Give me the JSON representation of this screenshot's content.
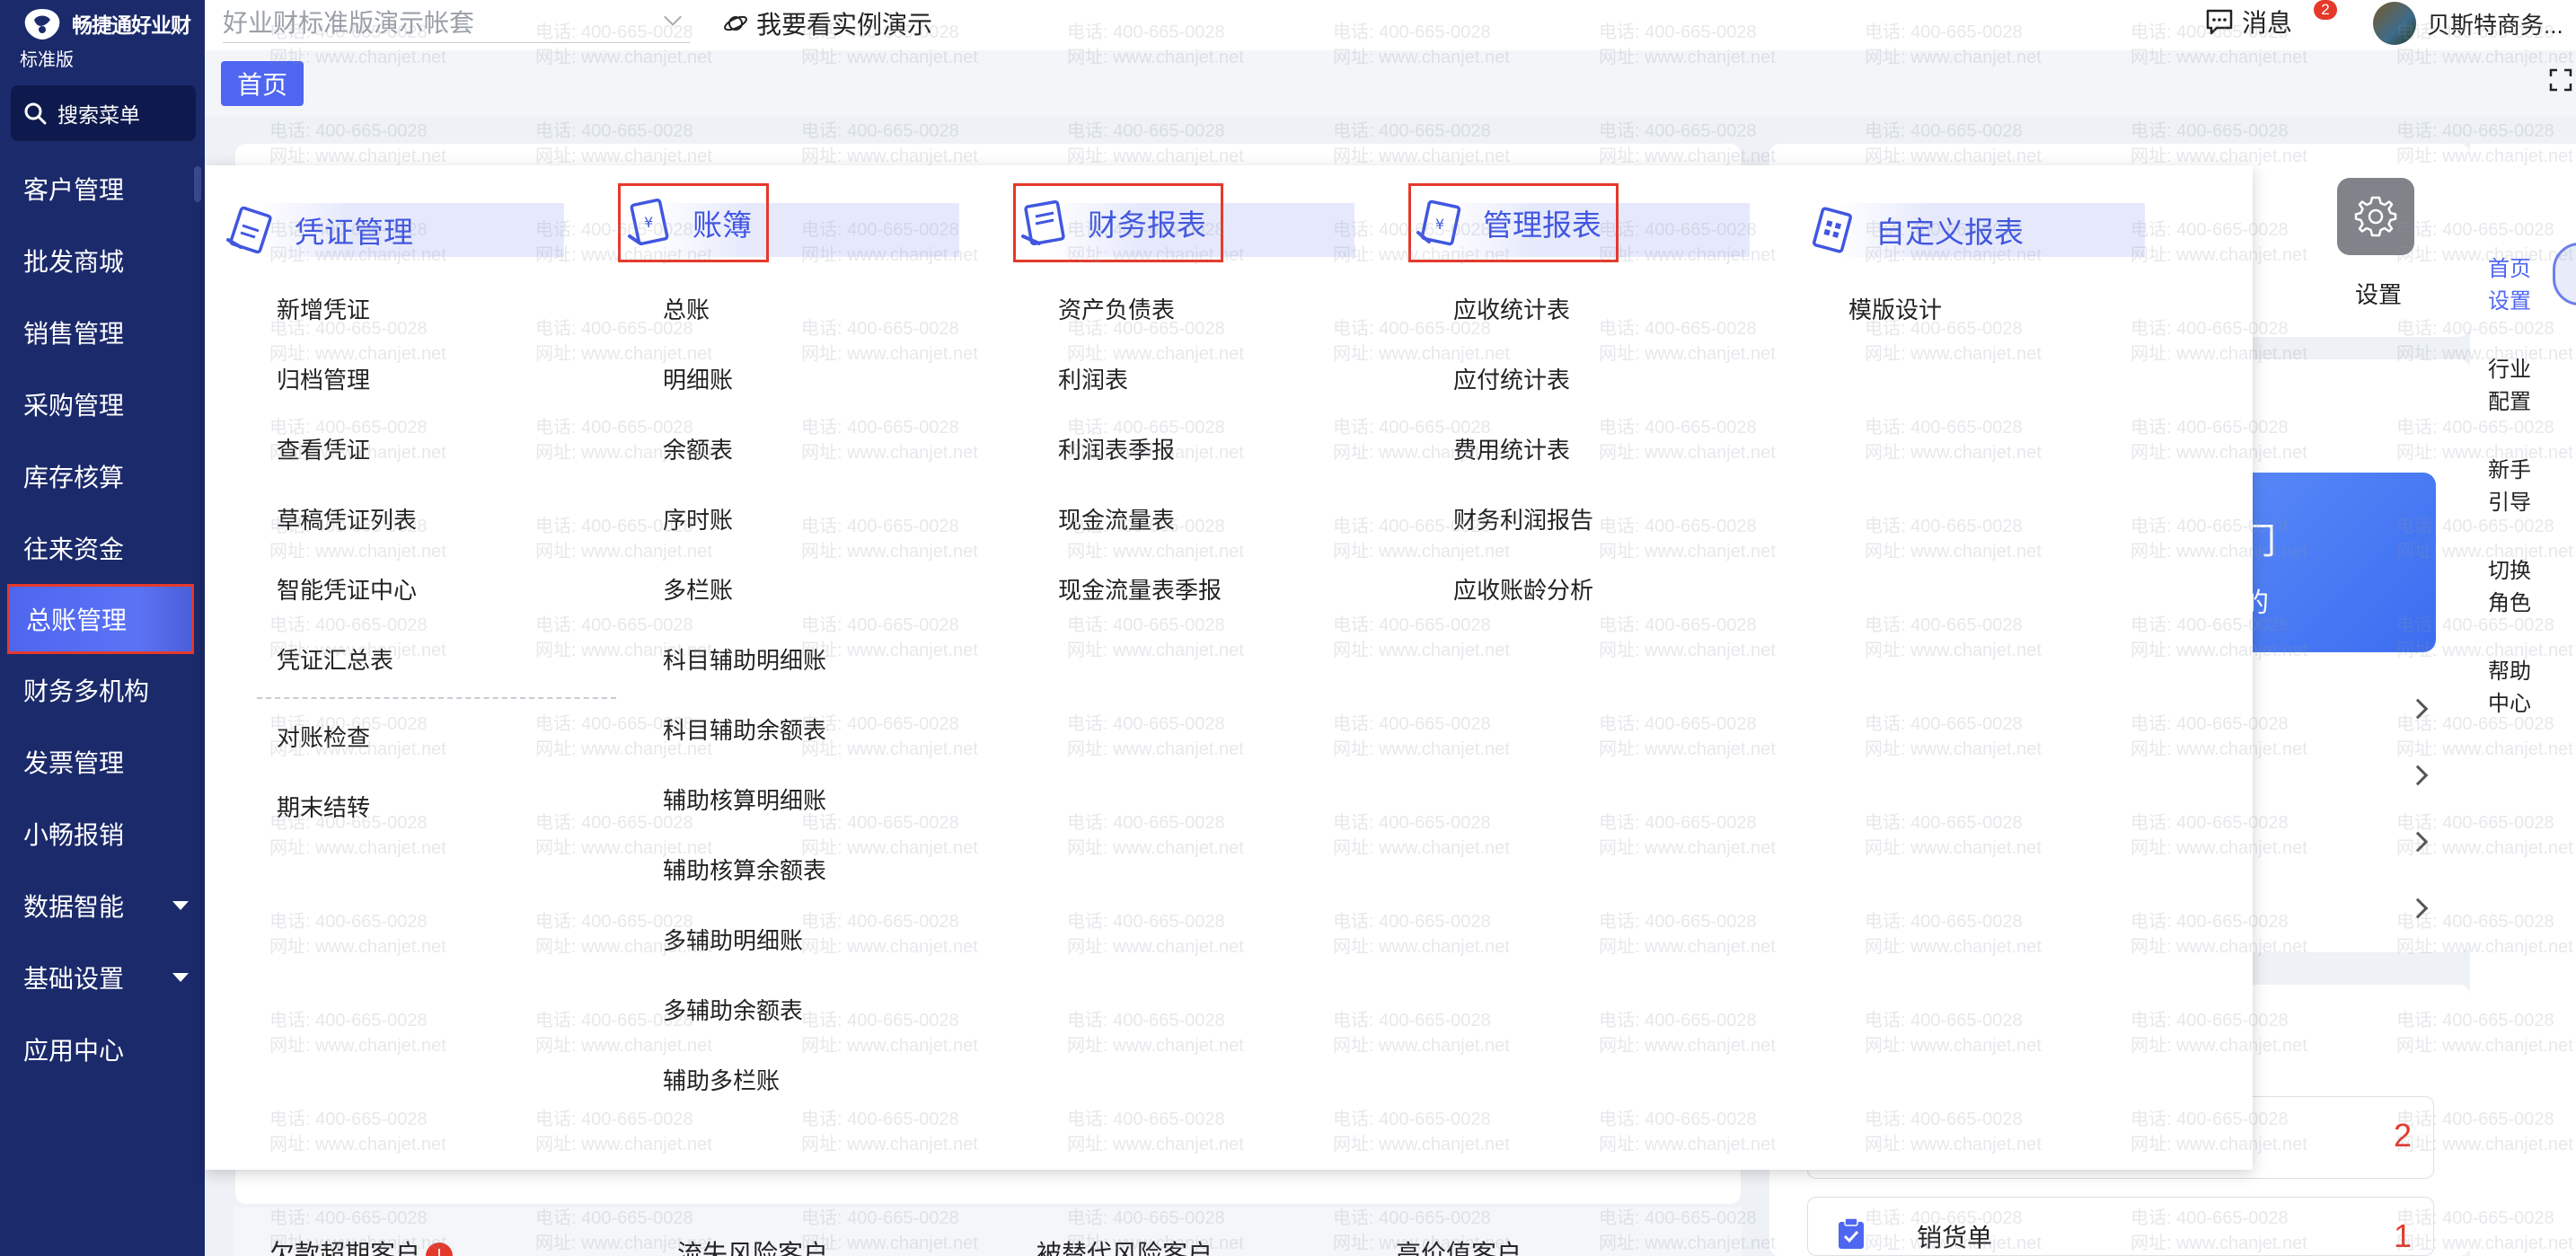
{
  "app": {
    "logo_text": "畅捷通好业财",
    "edition": "标准版",
    "search_menu_label": "搜索菜单"
  },
  "sidebar": {
    "items": [
      {
        "label": "客户管理"
      },
      {
        "label": "批发商城"
      },
      {
        "label": "销售管理"
      },
      {
        "label": "采购管理"
      },
      {
        "label": "库存核算"
      },
      {
        "label": "往来资金"
      },
      {
        "label": "总账管理",
        "active": true
      },
      {
        "label": "财务多机构"
      },
      {
        "label": "发票管理"
      },
      {
        "label": "小畅报销"
      },
      {
        "label": "数据智能",
        "has_submenu": true
      },
      {
        "label": "基础设置",
        "has_submenu": true
      },
      {
        "label": "应用中心"
      }
    ]
  },
  "topbar": {
    "account_placeholder": "好业财标准版演示帐套",
    "demo_link": "我要看实例演示",
    "messages_label": "消息",
    "messages_count": "2",
    "user_name": "贝斯特商务..."
  },
  "tabs": {
    "home": "首页"
  },
  "mega_menu": {
    "columns": [
      {
        "title": "凭证管理",
        "icon": "voucher-icon",
        "highlighted": false,
        "groups": [
          [
            "新增凭证",
            "归档管理",
            "查看凭证",
            "草稿凭证列表",
            "智能凭证中心",
            "凭证汇总表"
          ],
          [
            "对账检查",
            "期末结转"
          ]
        ]
      },
      {
        "title": "账簿",
        "icon": "ledger-icon",
        "highlighted": true,
        "groups": [
          [
            "总账",
            "明细账",
            "余额表",
            "序时账",
            "多栏账",
            "科目辅助明细账",
            "科目辅助余额表",
            "辅助核算明细账",
            "辅助核算余额表",
            "多辅助明细账",
            "多辅助余额表",
            "辅助多栏账"
          ]
        ]
      },
      {
        "title": "财务报表",
        "icon": "financial-report-icon",
        "highlighted": true,
        "groups": [
          [
            "资产负债表",
            "利润表",
            "利润表季报",
            "现金流量表",
            "现金流量表季报"
          ]
        ]
      },
      {
        "title": "管理报表",
        "icon": "management-report-icon",
        "highlighted": true,
        "groups": [
          [
            "应收统计表",
            "应付统计表",
            "费用统计表",
            "财务利润报告",
            "应收账龄分析"
          ]
        ]
      },
      {
        "title": "自定义报表",
        "icon": "custom-report-icon",
        "highlighted": false,
        "groups": [
          [
            "模版设计"
          ]
        ]
      }
    ]
  },
  "right_panel": {
    "settings_label": "设置",
    "promo_line1": "门",
    "promo_line2": "的",
    "rail": [
      {
        "label": "首页设置",
        "color": "#4f66f0"
      },
      {
        "label": "行业配置"
      },
      {
        "label": "新手引导"
      },
      {
        "label": "切换角色"
      },
      {
        "label": "帮助中心"
      }
    ],
    "counts": [
      "2",
      "1"
    ],
    "sales_label": "销货单"
  },
  "bottom_tabs": [
    {
      "label": "欠款超期客户",
      "badge": "!"
    },
    {
      "label": "流失风险客户"
    },
    {
      "label": "被替代风险客户"
    },
    {
      "label": "高价值客户"
    }
  ],
  "watermark": {
    "line1": "电话: 400-665-0028",
    "line2": "网址: www.chanjet.net"
  },
  "colors": {
    "sidebar_bg": "#1b2a6b",
    "accent": "#4f66f0",
    "highlight_border": "#e5392b",
    "menu_title": "#4157e0"
  }
}
